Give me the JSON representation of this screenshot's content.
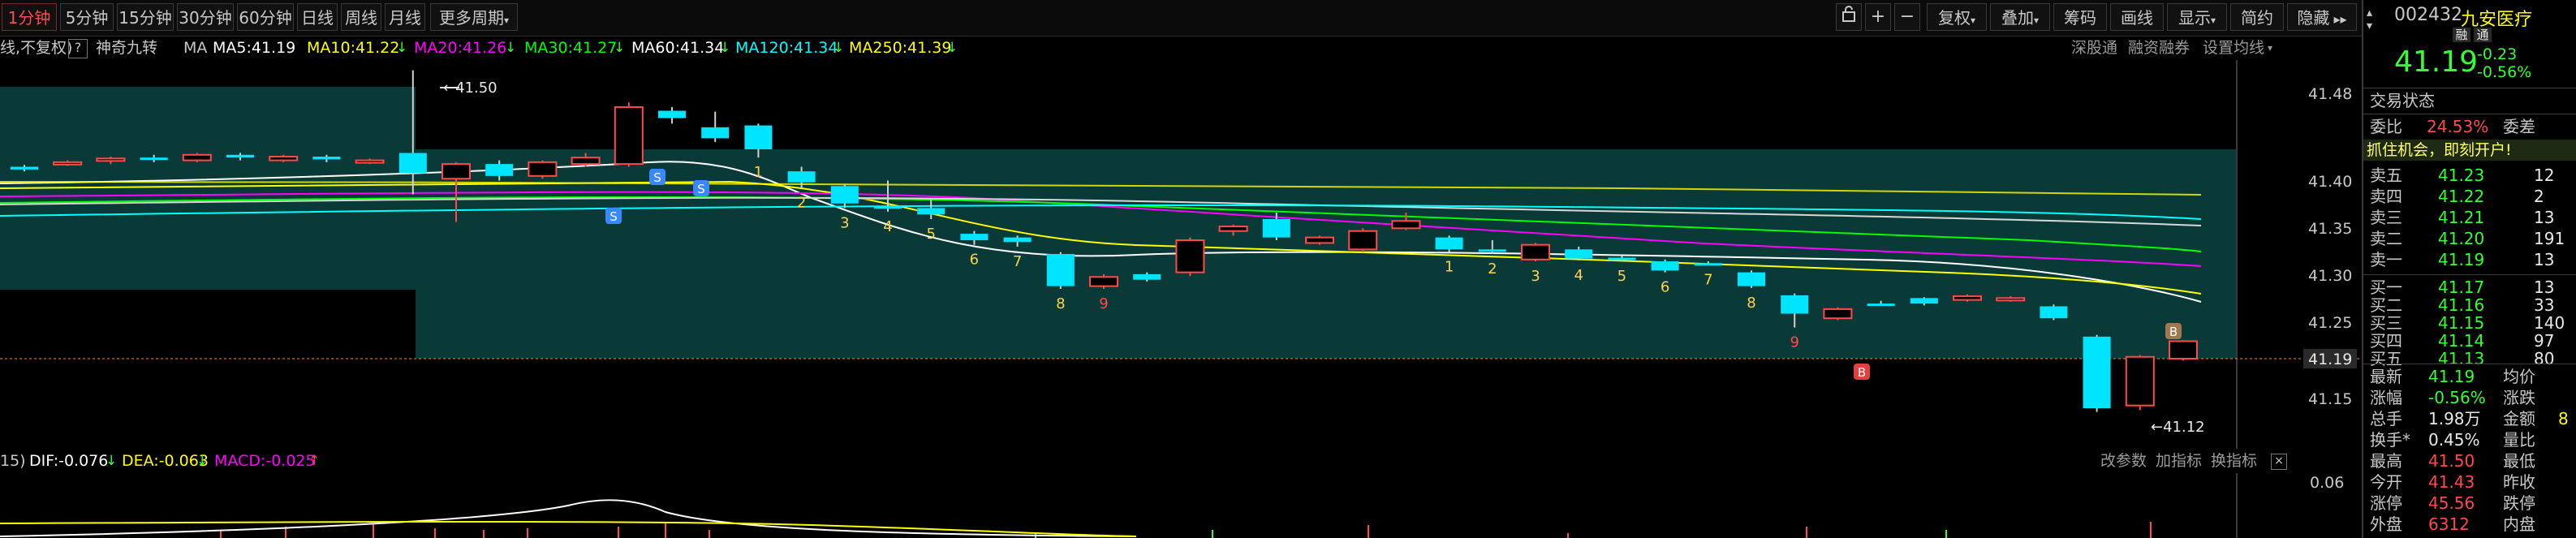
{
  "toolbar": {
    "periods": [
      "1分钟",
      "5分钟",
      "15分钟",
      "30分钟",
      "60分钟",
      "日线",
      "周线",
      "月线",
      "更多周期"
    ],
    "active_period": "1分钟",
    "right_buttons": [
      "复权",
      "叠加",
      "筹码",
      "画线",
      "显示",
      "简约",
      "隐藏"
    ],
    "icons": [
      "lock-icon",
      "plus-icon",
      "minus-icon"
    ]
  },
  "indicator_bar": {
    "mode": "线,不复权)",
    "help": "?",
    "name": "神奇九转",
    "ma_label": "MA",
    "ma5": "MA5:41.19",
    "ma10": "MA10:41.22",
    "ma20": "MA20:41.26",
    "ma30": "MA30:41.27",
    "ma60": "MA60:41.34",
    "ma120": "MA120:41.34",
    "ma250": "MA250:41.39",
    "links": [
      "深股通",
      "融资融券",
      "设置均线"
    ],
    "colors": {
      "ma5": "#ffffff",
      "ma10": "#ffff00",
      "ma20": "#ff00ff",
      "ma30": "#00ff00",
      "ma60": "#ffffff",
      "ma120": "#00ffff",
      "ma250": "#ffff00"
    }
  },
  "chart": {
    "y_ticks": [
      "41.48",
      "41.40",
      "41.35",
      "41.30",
      "41.25",
      "41.19",
      "41.15"
    ],
    "high_label": "41.50",
    "low_label": "41.12",
    "current_price_label": "41.19",
    "td_sequence_upper": [
      "1",
      "2",
      "3",
      "4",
      "5",
      "6",
      "7",
      "8",
      "9"
    ],
    "td_sequence_lower": [
      "1",
      "2",
      "3",
      "4",
      "5",
      "6",
      "7",
      "8",
      "9"
    ],
    "markers": {
      "sell": "S",
      "buy": "B"
    },
    "candles": [
      {
        "o": 41.395,
        "c": 41.392,
        "h": 41.397,
        "l": 41.39
      },
      {
        "o": 41.398,
        "c": 41.4,
        "h": 41.402,
        "l": 41.396
      },
      {
        "o": 41.402,
        "c": 41.404,
        "h": 41.406,
        "l": 41.398
      },
      {
        "o": 41.405,
        "c": 41.403,
        "h": 41.408,
        "l": 41.4
      },
      {
        "o": 41.402,
        "c": 41.408,
        "h": 41.41,
        "l": 41.4
      },
      {
        "o": 41.408,
        "c": 41.405,
        "h": 41.41,
        "l": 41.402
      },
      {
        "o": 41.402,
        "c": 41.406,
        "h": 41.408,
        "l": 41.4
      },
      {
        "o": 41.406,
        "c": 41.403,
        "h": 41.408,
        "l": 41.4
      },
      {
        "o": 41.4,
        "c": 41.402,
        "h": 41.404,
        "l": 41.398
      },
      {
        "o": 41.41,
        "c": 41.388,
        "h": 41.5,
        "l": 41.365
      },
      {
        "o": 41.382,
        "c": 41.398,
        "h": 41.4,
        "l": 41.335
      },
      {
        "o": 41.398,
        "c": 41.385,
        "h": 41.402,
        "l": 41.38
      },
      {
        "o": 41.385,
        "c": 41.4,
        "h": 41.402,
        "l": 41.382
      },
      {
        "o": 41.398,
        "c": 41.405,
        "h": 41.41,
        "l": 41.395
      },
      {
        "o": 41.398,
        "c": 41.46,
        "h": 41.465,
        "l": 41.395
      },
      {
        "o": 41.456,
        "c": 41.448,
        "h": 41.46,
        "l": 41.442
      },
      {
        "o": 41.438,
        "c": 41.426,
        "h": 41.455,
        "l": 41.422
      },
      {
        "o": 41.44,
        "c": 41.414,
        "h": 41.442,
        "l": 41.405
      },
      {
        "o": 41.39,
        "c": 41.378,
        "h": 41.395,
        "l": 41.372
      },
      {
        "o": 41.374,
        "c": 41.355,
        "h": 41.376,
        "l": 41.35
      },
      {
        "o": 41.352,
        "c": 41.35,
        "h": 41.38,
        "l": 41.346
      },
      {
        "o": 41.35,
        "c": 41.343,
        "h": 41.36,
        "l": 41.338
      },
      {
        "o": 41.322,
        "c": 41.315,
        "h": 41.325,
        "l": 41.31
      },
      {
        "o": 41.318,
        "c": 41.313,
        "h": 41.32,
        "l": 41.308
      },
      {
        "o": 41.3,
        "c": 41.265,
        "h": 41.302,
        "l": 41.262
      },
      {
        "o": 41.265,
        "c": 41.275,
        "h": 41.278,
        "l": 41.262
      },
      {
        "o": 41.278,
        "c": 41.272,
        "h": 41.28,
        "l": 41.27
      },
      {
        "o": 41.28,
        "c": 41.315,
        "h": 41.318,
        "l": 41.276
      },
      {
        "o": 41.325,
        "c": 41.33,
        "h": 41.332,
        "l": 41.32
      },
      {
        "o": 41.338,
        "c": 41.318,
        "h": 41.345,
        "l": 41.315
      },
      {
        "o": 41.312,
        "c": 41.318,
        "h": 41.32,
        "l": 41.31
      },
      {
        "o": 41.305,
        "c": 41.325,
        "h": 41.328,
        "l": 41.302
      },
      {
        "o": 41.328,
        "c": 41.336,
        "h": 41.345,
        "l": 41.326
      },
      {
        "o": 41.318,
        "c": 41.305,
        "h": 41.32,
        "l": 41.302
      },
      {
        "o": 41.305,
        "c": 41.303,
        "h": 41.315,
        "l": 41.3
      },
      {
        "o": 41.294,
        "c": 41.31,
        "h": 41.312,
        "l": 41.292
      },
      {
        "o": 41.305,
        "c": 41.295,
        "h": 41.308,
        "l": 41.293
      },
      {
        "o": 41.296,
        "c": 41.295,
        "h": 41.298,
        "l": 41.292
      },
      {
        "o": 41.292,
        "c": 41.282,
        "h": 41.294,
        "l": 41.28
      },
      {
        "o": 41.29,
        "c": 41.29,
        "h": 41.292,
        "l": 41.288
      },
      {
        "o": 41.28,
        "c": 41.265,
        "h": 41.282,
        "l": 41.263
      },
      {
        "o": 41.255,
        "c": 41.235,
        "h": 41.257,
        "l": 41.22
      },
      {
        "o": 41.23,
        "c": 41.24,
        "h": 41.242,
        "l": 41.228
      },
      {
        "o": 41.246,
        "c": 41.246,
        "h": 41.249,
        "l": 41.244
      },
      {
        "o": 41.252,
        "c": 41.246,
        "h": 41.253,
        "l": 41.244
      },
      {
        "o": 41.25,
        "c": 41.254,
        "h": 41.256,
        "l": 41.248
      },
      {
        "o": 41.25,
        "c": 41.252,
        "h": 41.254,
        "l": 41.248
      },
      {
        "o": 41.243,
        "c": 41.23,
        "h": 41.245,
        "l": 41.228
      },
      {
        "o": 41.21,
        "c": 41.132,
        "h": 41.212,
        "l": 41.128
      },
      {
        "o": 41.135,
        "c": 41.188,
        "h": 41.19,
        "l": 41.13
      },
      {
        "o": 41.186,
        "c": 41.205,
        "h": 41.206,
        "l": 41.184
      }
    ]
  },
  "macd": {
    "period_label": "15)",
    "dif": "DIF:-0.076",
    "dea": "DEA:-0.063",
    "macd": "MACD:-0.025",
    "links": [
      "改参数",
      "加指标",
      "换指标"
    ],
    "y_tick": "0.06",
    "colors": {
      "dif": "#ffffff",
      "dea": "#ffff00",
      "macd": "#ff00ff"
    }
  },
  "panel": {
    "code": "002432",
    "name": "九安医疗",
    "tags": [
      "融",
      "通"
    ],
    "price": "41.19",
    "change": "-0.23",
    "change_pct": "-0.56%",
    "trade_status_label": "交易状态",
    "wei_bi_label": "委比",
    "wei_bi": "24.53%",
    "wei_cha_label": "委差",
    "promo": "抓住机会，即刻开户!",
    "sells": [
      {
        "label": "卖五",
        "price": "41.23",
        "vol": "12"
      },
      {
        "label": "卖四",
        "price": "41.22",
        "vol": "2"
      },
      {
        "label": "卖三",
        "price": "41.21",
        "vol": "13"
      },
      {
        "label": "卖二",
        "price": "41.20",
        "vol": "191"
      },
      {
        "label": "卖一",
        "price": "41.19",
        "vol": "13"
      }
    ],
    "buys": [
      {
        "label": "买一",
        "price": "41.17",
        "vol": "13"
      },
      {
        "label": "买二",
        "price": "41.16",
        "vol": "33"
      },
      {
        "label": "买三",
        "price": "41.15",
        "vol": "140"
      },
      {
        "label": "买四",
        "price": "41.14",
        "vol": "97"
      },
      {
        "label": "买五",
        "price": "41.13",
        "vol": "80"
      }
    ],
    "stats": [
      {
        "l1": "最新",
        "v1": "41.19",
        "c1": "green",
        "l2": "均价",
        "v2": "",
        "c2": "white"
      },
      {
        "l1": "涨幅",
        "v1": "-0.56%",
        "c1": "green",
        "l2": "涨跌",
        "v2": "",
        "c2": "white"
      },
      {
        "l1": "总手",
        "v1": "1.98万",
        "c1": "white",
        "l2": "金额",
        "v2": "8",
        "c2": "yellow"
      },
      {
        "l1": "换手*",
        "v1": "0.45%",
        "c1": "white",
        "l2": "量比",
        "v2": "",
        "c2": "white"
      },
      {
        "l1": "最高",
        "v1": "41.50",
        "c1": "red",
        "l2": "最低",
        "v2": "",
        "c2": "white"
      },
      {
        "l1": "今开",
        "v1": "41.43",
        "c1": "red",
        "l2": "昨收",
        "v2": "",
        "c2": "white"
      },
      {
        "l1": "涨停",
        "v1": "45.56",
        "c1": "red",
        "l2": "跌停",
        "v2": "",
        "c2": "white"
      },
      {
        "l1": "外盘",
        "v1": "6312",
        "c1": "red",
        "l2": "内盘",
        "v2": "",
        "c2": "white"
      }
    ]
  }
}
